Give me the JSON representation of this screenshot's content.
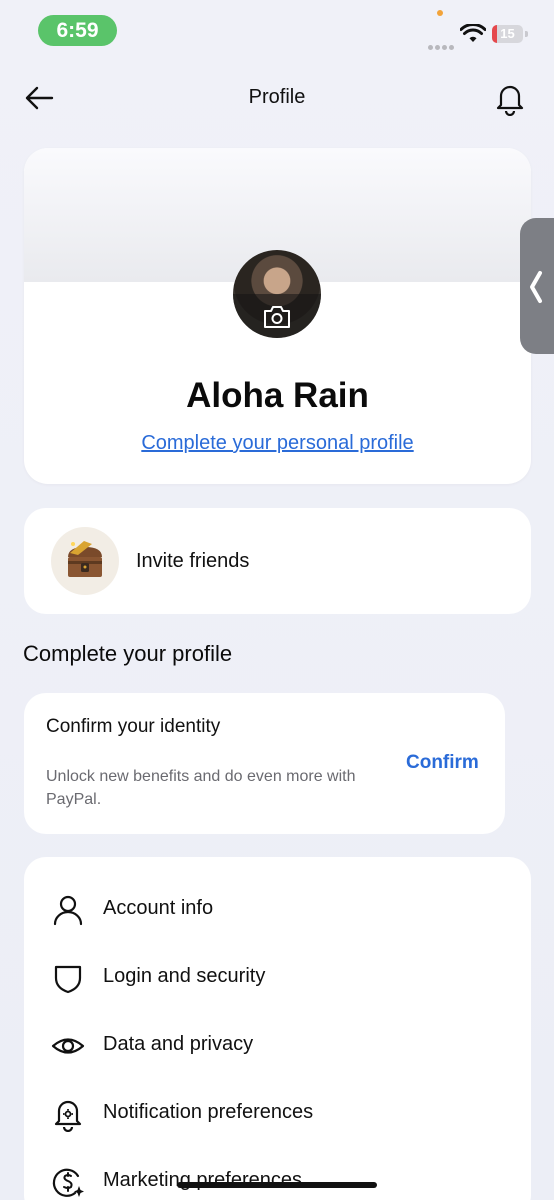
{
  "status_bar": {
    "time": "6:59",
    "battery": "15",
    "battery_level": 0.15
  },
  "header": {
    "title": "Profile"
  },
  "profile": {
    "name": "Aloha Rain",
    "complete_link": "Complete your personal profile"
  },
  "invite": {
    "label": "Invite friends"
  },
  "complete_profile": {
    "section_title": "Complete your profile",
    "identity_title": "Confirm your identity",
    "identity_desc": "Unlock new benefits and do even more with PayPal.",
    "confirm_label": "Confirm"
  },
  "settings": {
    "items": [
      {
        "label": "Account info",
        "icon": "person-icon"
      },
      {
        "label": "Login and security",
        "icon": "shield-icon"
      },
      {
        "label": "Data and privacy",
        "icon": "eye-icon"
      },
      {
        "label": "Notification preferences",
        "icon": "bell-gear-icon"
      },
      {
        "label": "Marketing preferences",
        "icon": "dollar-sparkle-icon"
      }
    ]
  },
  "colors": {
    "accent": "#2a6bd8",
    "status_green": "#5ac46a",
    "battery_red": "#e5484d",
    "background": "#eef0f7"
  }
}
